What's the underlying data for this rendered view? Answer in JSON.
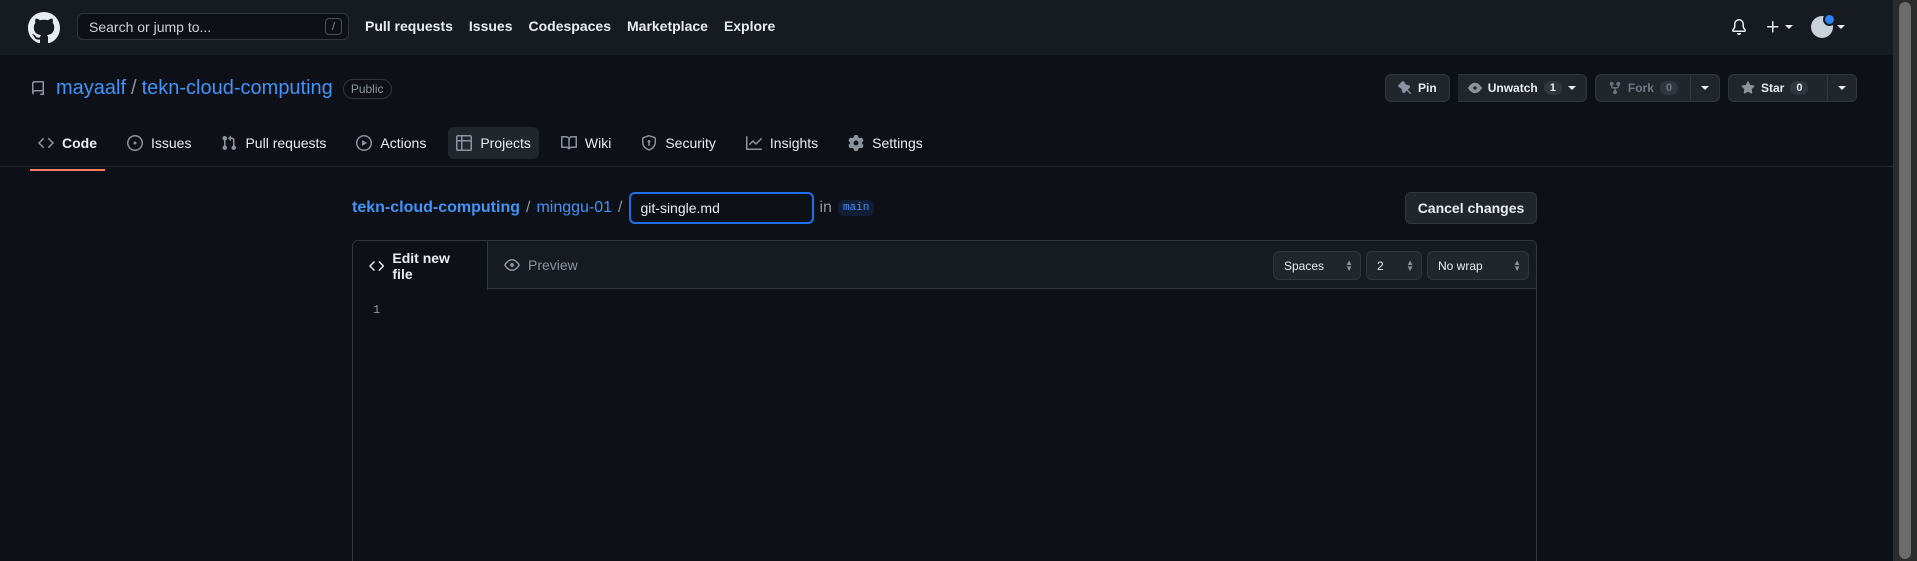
{
  "header": {
    "search_placeholder": "Search or jump to...",
    "search_shortcut": "/",
    "nav": [
      "Pull requests",
      "Issues",
      "Codespaces",
      "Marketplace",
      "Explore"
    ]
  },
  "repo": {
    "owner": "mayaalf",
    "separator": "/",
    "name": "tekn-cloud-computing",
    "visibility": "Public",
    "pin_label": "Pin",
    "unwatch_label": "Unwatch",
    "watch_count": "1",
    "fork_label": "Fork",
    "fork_count": "0",
    "star_label": "Star",
    "star_count": "0"
  },
  "tabs": [
    {
      "label": "Code",
      "icon": "code-icon"
    },
    {
      "label": "Issues",
      "icon": "issue-icon"
    },
    {
      "label": "Pull requests",
      "icon": "pull-request-icon"
    },
    {
      "label": "Actions",
      "icon": "play-icon"
    },
    {
      "label": "Projects",
      "icon": "table-icon"
    },
    {
      "label": "Wiki",
      "icon": "book-icon"
    },
    {
      "label": "Security",
      "icon": "shield-icon"
    },
    {
      "label": "Insights",
      "icon": "graph-icon"
    },
    {
      "label": "Settings",
      "icon": "gear-icon"
    }
  ],
  "breadcrumb": {
    "repo": "tekn-cloud-computing",
    "folder": "minggu-01",
    "sep": "/",
    "filename_value": "git-single.md",
    "in_label": "in",
    "branch": "main"
  },
  "cancel_label": "Cancel changes",
  "editor": {
    "edit_tab": "Edit new file",
    "preview_tab": "Preview",
    "indent_mode": "Spaces",
    "indent_size": "2",
    "wrap_mode": "No wrap",
    "line_number": "1"
  },
  "colors": {
    "accent_link": "#4493f8",
    "active_tab_underline": "#f78166",
    "background": "#0d1117",
    "header_bg": "#161b22"
  }
}
